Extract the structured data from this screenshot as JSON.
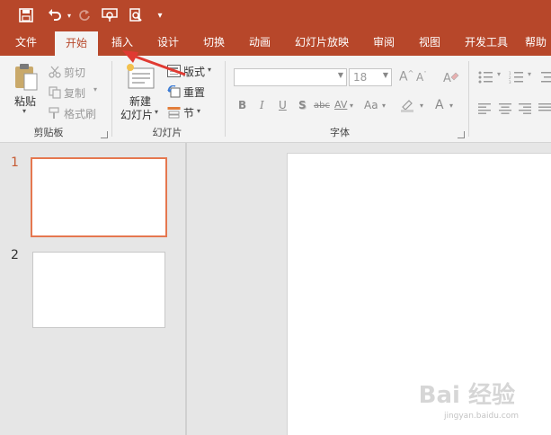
{
  "quick_access": {
    "icons": [
      "save-icon",
      "undo-icon",
      "redo-icon",
      "start-slideshow-icon",
      "print-preview-icon",
      "customize-qat-icon"
    ]
  },
  "tabs": [
    "文件",
    "开始",
    "插入",
    "设计",
    "切换",
    "动画",
    "幻灯片放映",
    "审阅",
    "视图",
    "开发工具",
    "帮助"
  ],
  "active_tab": "开始",
  "ribbon": {
    "clipboard": {
      "label": "剪贴板",
      "paste": "粘贴",
      "cut": "剪切",
      "copy": "复制",
      "format_painter": "格式刷"
    },
    "slides": {
      "label": "幻灯片",
      "new_slide_line1": "新建",
      "new_slide_line2": "幻灯片",
      "layout": "版式",
      "reset": "重置",
      "section": "节"
    },
    "font": {
      "label": "字体",
      "font_name": "",
      "font_size": "18",
      "buttons": [
        "B",
        "I",
        "U",
        "S",
        "abc",
        "AV",
        "Aa",
        "A"
      ]
    }
  },
  "slides": [
    {
      "number": "1",
      "selected": true
    },
    {
      "number": "2",
      "selected": false
    }
  ],
  "colors": {
    "accent": "#b7472a",
    "selected_thumb_border": "#e5774f",
    "arrow_annotation": "#e03a32"
  },
  "watermark": {
    "logo": "Bai 经验",
    "url": "jingyan.baidu.com"
  }
}
